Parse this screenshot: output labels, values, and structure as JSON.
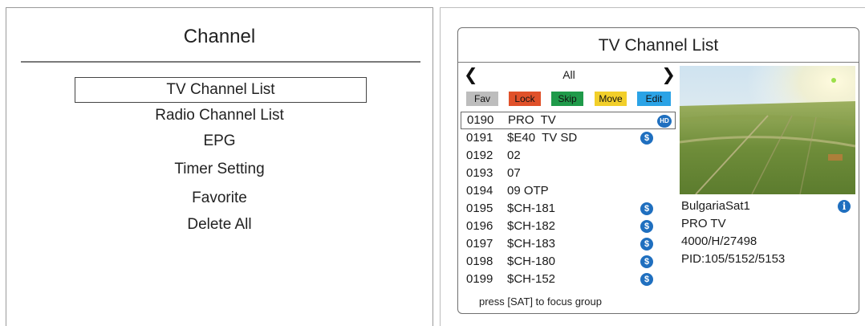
{
  "channel_menu": {
    "title": "Channel",
    "items": [
      {
        "label": "TV Channel List",
        "selected": true
      },
      {
        "label": "Radio Channel List",
        "selected": false
      },
      {
        "label": "EPG",
        "selected": false
      },
      {
        "label": "Timer Setting",
        "selected": false
      },
      {
        "label": "Favorite",
        "selected": false
      },
      {
        "label": "Delete All",
        "selected": false
      }
    ]
  },
  "tv_channel_list": {
    "title": "TV Channel List",
    "group": {
      "name": "All",
      "prev_icon": "chevron-left-icon",
      "next_icon": "chevron-right-icon"
    },
    "buttons": [
      {
        "label": "Fav",
        "color": "#bdbdbd"
      },
      {
        "label": "Lock",
        "color": "#e0512a"
      },
      {
        "label": "Skip",
        "color": "#1f9a4a"
      },
      {
        "label": "Move",
        "color": "#f2cf2a"
      },
      {
        "label": "Edit",
        "color": "#2ba3e6"
      }
    ],
    "channels": [
      {
        "number": "0190",
        "name": "PRO  TV",
        "badge": "HD",
        "selected": true
      },
      {
        "number": "0191",
        "name": "$E40  TV SD",
        "badge": "$",
        "selected": false
      },
      {
        "number": "0192",
        "name": "02",
        "badge": "",
        "selected": false
      },
      {
        "number": "0193",
        "name": "07",
        "badge": "",
        "selected": false
      },
      {
        "number": "0194",
        "name": "09 OTP",
        "badge": "",
        "selected": false
      },
      {
        "number": "0195",
        "name": "$CH-181",
        "badge": "$",
        "selected": false
      },
      {
        "number": "0196",
        "name": "$CH-182",
        "badge": "$",
        "selected": false
      },
      {
        "number": "0197",
        "name": "$CH-183",
        "badge": "$",
        "selected": false
      },
      {
        "number": "0198",
        "name": "$CH-180",
        "badge": "$",
        "selected": false
      },
      {
        "number": "0199",
        "name": "$CH-152",
        "badge": "$",
        "selected": false
      }
    ],
    "hint": "press [SAT] to focus group",
    "info": {
      "satellite": "BulgariaSat1",
      "channel": "PRO TV",
      "transponder": "4000/H/27498",
      "pids": "PID:105/5152/5153",
      "info_icon": "info-icon"
    },
    "colors": {
      "badge": "#1f6fbf",
      "frame_border": "#707070"
    }
  }
}
